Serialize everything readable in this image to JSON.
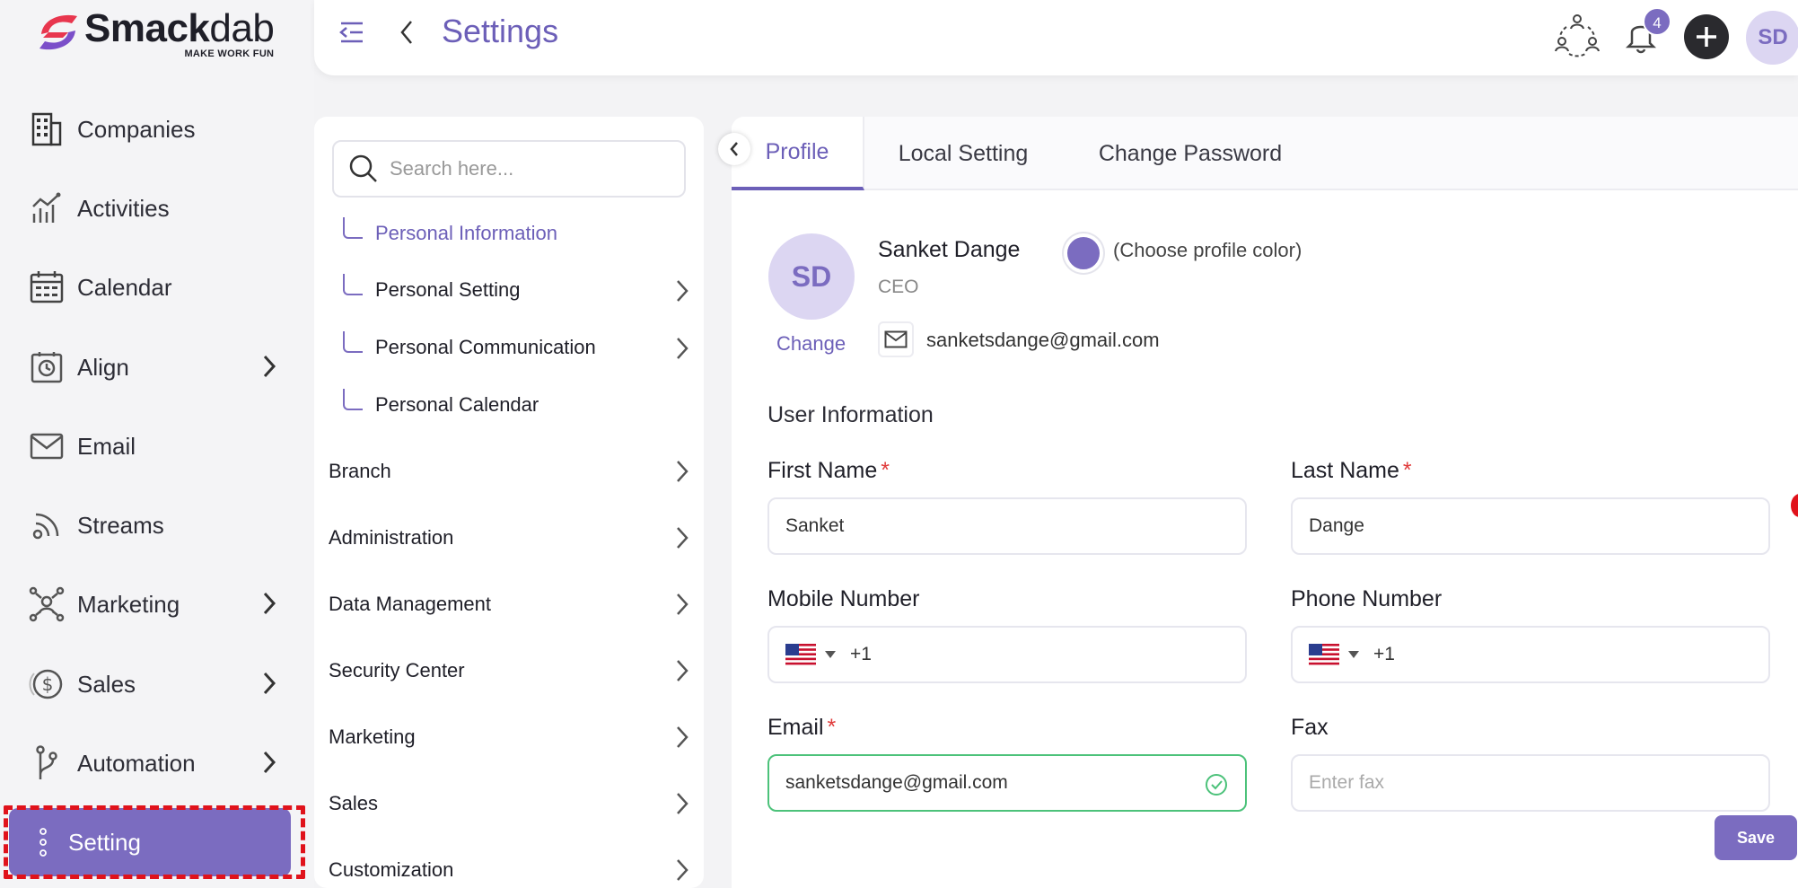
{
  "brand": {
    "name_bold": "Smack",
    "name_thin": "dab",
    "tagline": "MAKE WORK FUN"
  },
  "header": {
    "title": "Settings",
    "notification_count": "4",
    "user_initials": "SD"
  },
  "sidebar": {
    "items": [
      {
        "label": "Companies",
        "icon": "building-icon"
      },
      {
        "label": "Activities",
        "icon": "activity-chart-icon"
      },
      {
        "label": "Calendar",
        "icon": "calendar-icon"
      },
      {
        "label": "Align",
        "icon": "clock-board-icon"
      },
      {
        "label": "Email",
        "icon": "mail-icon"
      },
      {
        "label": "Streams",
        "icon": "rss-icon"
      },
      {
        "label": "Marketing",
        "icon": "network-user-icon"
      },
      {
        "label": "Sales",
        "icon": "dollar-coin-icon"
      },
      {
        "label": "Automation",
        "icon": "git-branch-icon"
      }
    ],
    "active": {
      "label": "Setting",
      "icon": "dots-vertical-icon"
    }
  },
  "submenu": {
    "search_placeholder": "Search here...",
    "children": [
      "Personal Information",
      "Personal Setting",
      "Personal Communication",
      "Personal Calendar"
    ],
    "sections": [
      "Branch",
      "Administration",
      "Data Management",
      "Security Center",
      "Marketing",
      "Sales",
      "Customization"
    ]
  },
  "tabs": {
    "profile": "Profile",
    "local": "Local Setting",
    "password": "Change Password"
  },
  "profile": {
    "initials": "SD",
    "change_label": "Change",
    "name": "Sanket Dange",
    "role": "CEO",
    "color_label": "(Choose profile color)",
    "email": "sanketsdange@gmail.com",
    "color": "#7b6cc0"
  },
  "form": {
    "section_title": "User Information",
    "first_name_label": "First Name",
    "first_name_value": "Sanket",
    "last_name_label": "Last Name",
    "last_name_value": "Dange",
    "mobile_label": "Mobile Number",
    "mobile_code": "+1",
    "phone_label": "Phone Number",
    "phone_code": "+1",
    "email_label": "Email",
    "email_value": "sanketsdange@gmail.com",
    "fax_label": "Fax",
    "fax_placeholder": "Enter fax",
    "required_mark": "*"
  },
  "actions": {
    "save_label": "Save"
  },
  "colors": {
    "accent": "#7b6cc0",
    "highlight": "#e0121b",
    "valid": "#4cc27a"
  }
}
